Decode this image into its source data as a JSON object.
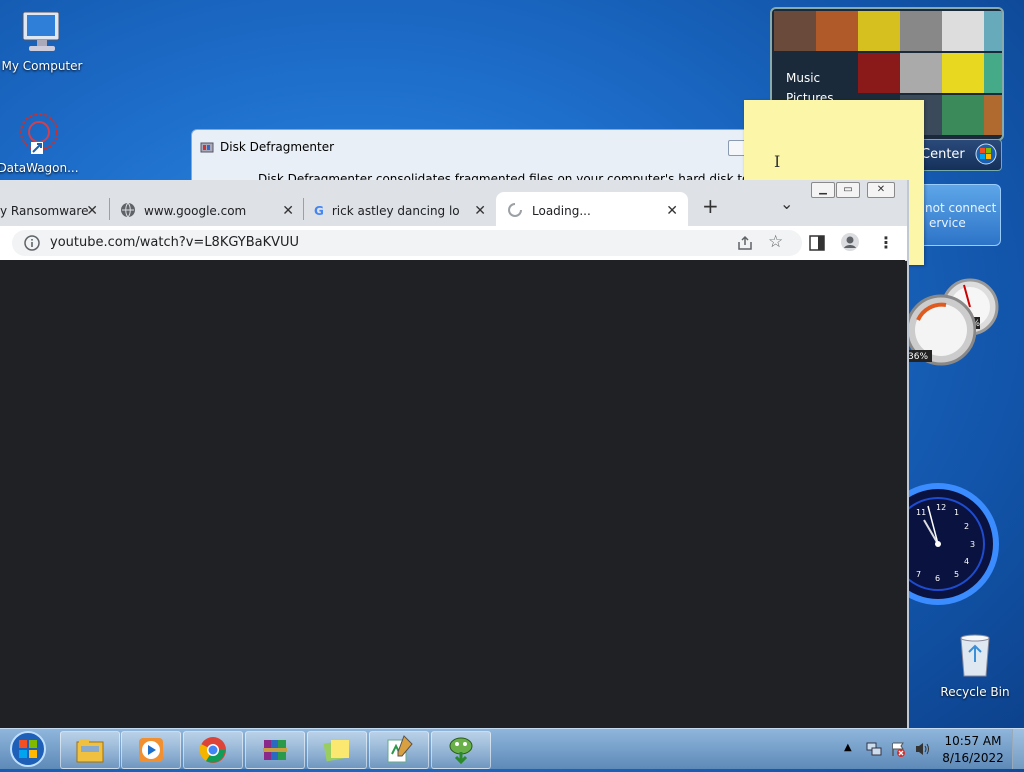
{
  "desktop": {
    "icons": [
      {
        "label": "My Computer",
        "icon": "computer-icon"
      },
      {
        "label": "DataWagon...",
        "icon": "datawagon-icon"
      },
      {
        "label": "Recycle Bin",
        "icon": "recycle-bin-icon"
      }
    ]
  },
  "gadgets": {
    "media_center": {
      "labels": [
        "Music",
        "Pictures"
      ],
      "bar_label": "Center"
    },
    "notice": {
      "line1": "not connect",
      "line2": "ervice"
    },
    "gauges": {
      "cpu": "38%",
      "mem": "36%"
    },
    "clock": {
      "hour": 11,
      "minute": 57
    }
  },
  "defrag_window": {
    "title": "Disk Defragmenter",
    "body": "Disk Defragmenter consolidates fragmented files on your computer's hard disk to improve s..."
  },
  "browser": {
    "tabs": [
      {
        "label": "y Ransomware",
        "icon": "none"
      },
      {
        "label": "www.google.com",
        "icon": "globe-icon"
      },
      {
        "label": "rick astley dancing loop",
        "icon": "google-icon"
      },
      {
        "label": "Loading...",
        "icon": "spinner-icon",
        "active": true
      }
    ],
    "new_tab": "+",
    "tab_search": "⌄",
    "url": "youtube.com/watch?v=L8KGYBaKVUU"
  },
  "taskbar": {
    "pinned": [
      "explorer-icon",
      "media-player-icon",
      "chrome-icon",
      "winrar-icon",
      "sticky-notes-icon",
      "notepad-icon",
      "install-icon"
    ],
    "time": "10:57 AM",
    "date": "8/16/2022"
  },
  "colors": {
    "accent": "#1e6fcc",
    "sticky": "#fbf6a8",
    "content_bg": "#202124"
  }
}
